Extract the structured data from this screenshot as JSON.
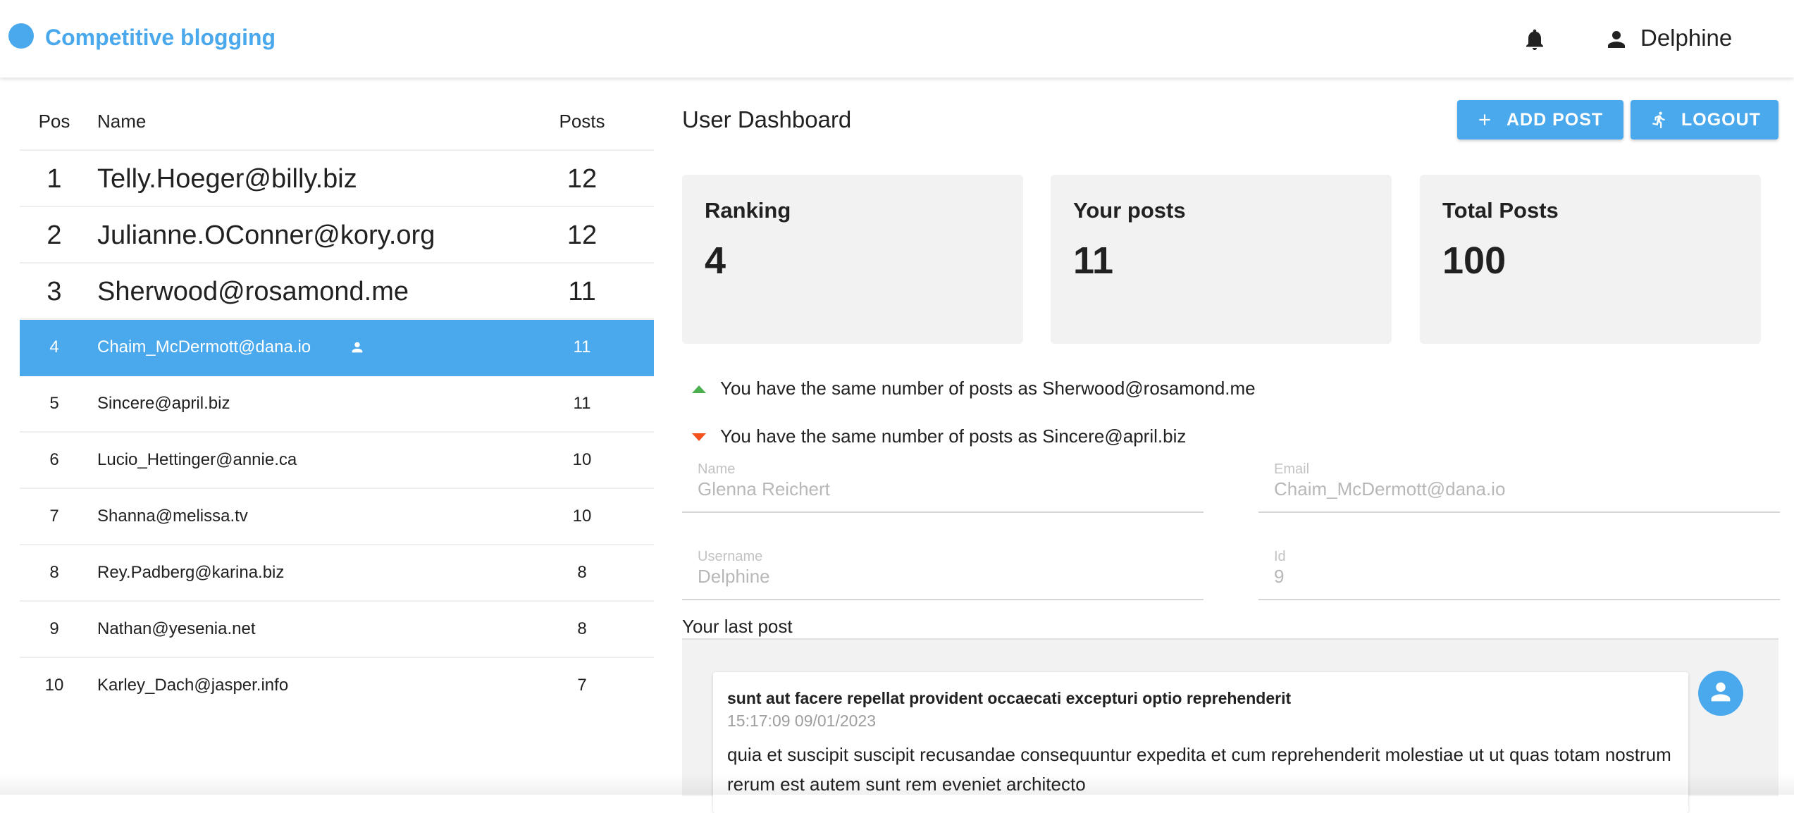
{
  "header": {
    "app_title": "Competitive blogging",
    "user_name": "Delphine",
    "icons": [
      "logo-circle-icon",
      "bell-icon",
      "person-icon"
    ]
  },
  "leaderboard": {
    "columns": [
      "Pos",
      "Name",
      "Posts"
    ],
    "rows": [
      {
        "pos": "1",
        "name": "Telly.Hoeger@billy.biz",
        "posts": "12"
      },
      {
        "pos": "2",
        "name": "Julianne.OConner@kory.org",
        "posts": "12"
      },
      {
        "pos": "3",
        "name": "Sherwood@rosamond.me",
        "posts": "11"
      },
      {
        "pos": "4",
        "name": "Chaim_McDermott@dana.io",
        "posts": "11",
        "current_user": true
      },
      {
        "pos": "5",
        "name": "Sincere@april.biz",
        "posts": "11"
      },
      {
        "pos": "6",
        "name": "Lucio_Hettinger@annie.ca",
        "posts": "10"
      },
      {
        "pos": "7",
        "name": "Shanna@melissa.tv",
        "posts": "10"
      },
      {
        "pos": "8",
        "name": "Rey.Padberg@karina.biz",
        "posts": "8"
      },
      {
        "pos": "9",
        "name": "Nathan@yesenia.net",
        "posts": "8"
      },
      {
        "pos": "10",
        "name": "Karley_Dach@jasper.info",
        "posts": "7"
      }
    ]
  },
  "dashboard": {
    "title": "User Dashboard",
    "add_post_label": "ADD POST",
    "logout_label": "LOGOUT",
    "cards": [
      {
        "label": "Ranking",
        "value": "4"
      },
      {
        "label": "Your posts",
        "value": "11"
      },
      {
        "label": "Total Posts",
        "value": "100"
      }
    ],
    "comparison_above": "You have the same number of posts as Sherwood@rosamond.me",
    "comparison_below": "You have the same number of posts as Sincere@april.biz",
    "fields": {
      "name_label": "Name",
      "name_value": "Glenna Reichert",
      "email_label": "Email",
      "email_value": "Chaim_McDermott@dana.io",
      "username_label": "Username",
      "username_value": "Delphine",
      "id_label": "Id",
      "id_value": "9"
    },
    "last_post_label": "Your last post",
    "last_post": {
      "title": "sunt aut facere repellat provident occaecati excepturi optio reprehenderit",
      "timestamp": "15:17:09 09/01/2023",
      "body": "quia et suscipit suscipit recusandae consequuntur expedita et cum reprehenderit molestiae ut ut quas totam nostrum rerum est autem sunt rem eveniet architecto"
    }
  },
  "colors": {
    "accent": "#4aa8ec",
    "up_arrow": "#4caf50",
    "down_arrow": "#f4511e",
    "card_bg": "#f2f2f2"
  }
}
